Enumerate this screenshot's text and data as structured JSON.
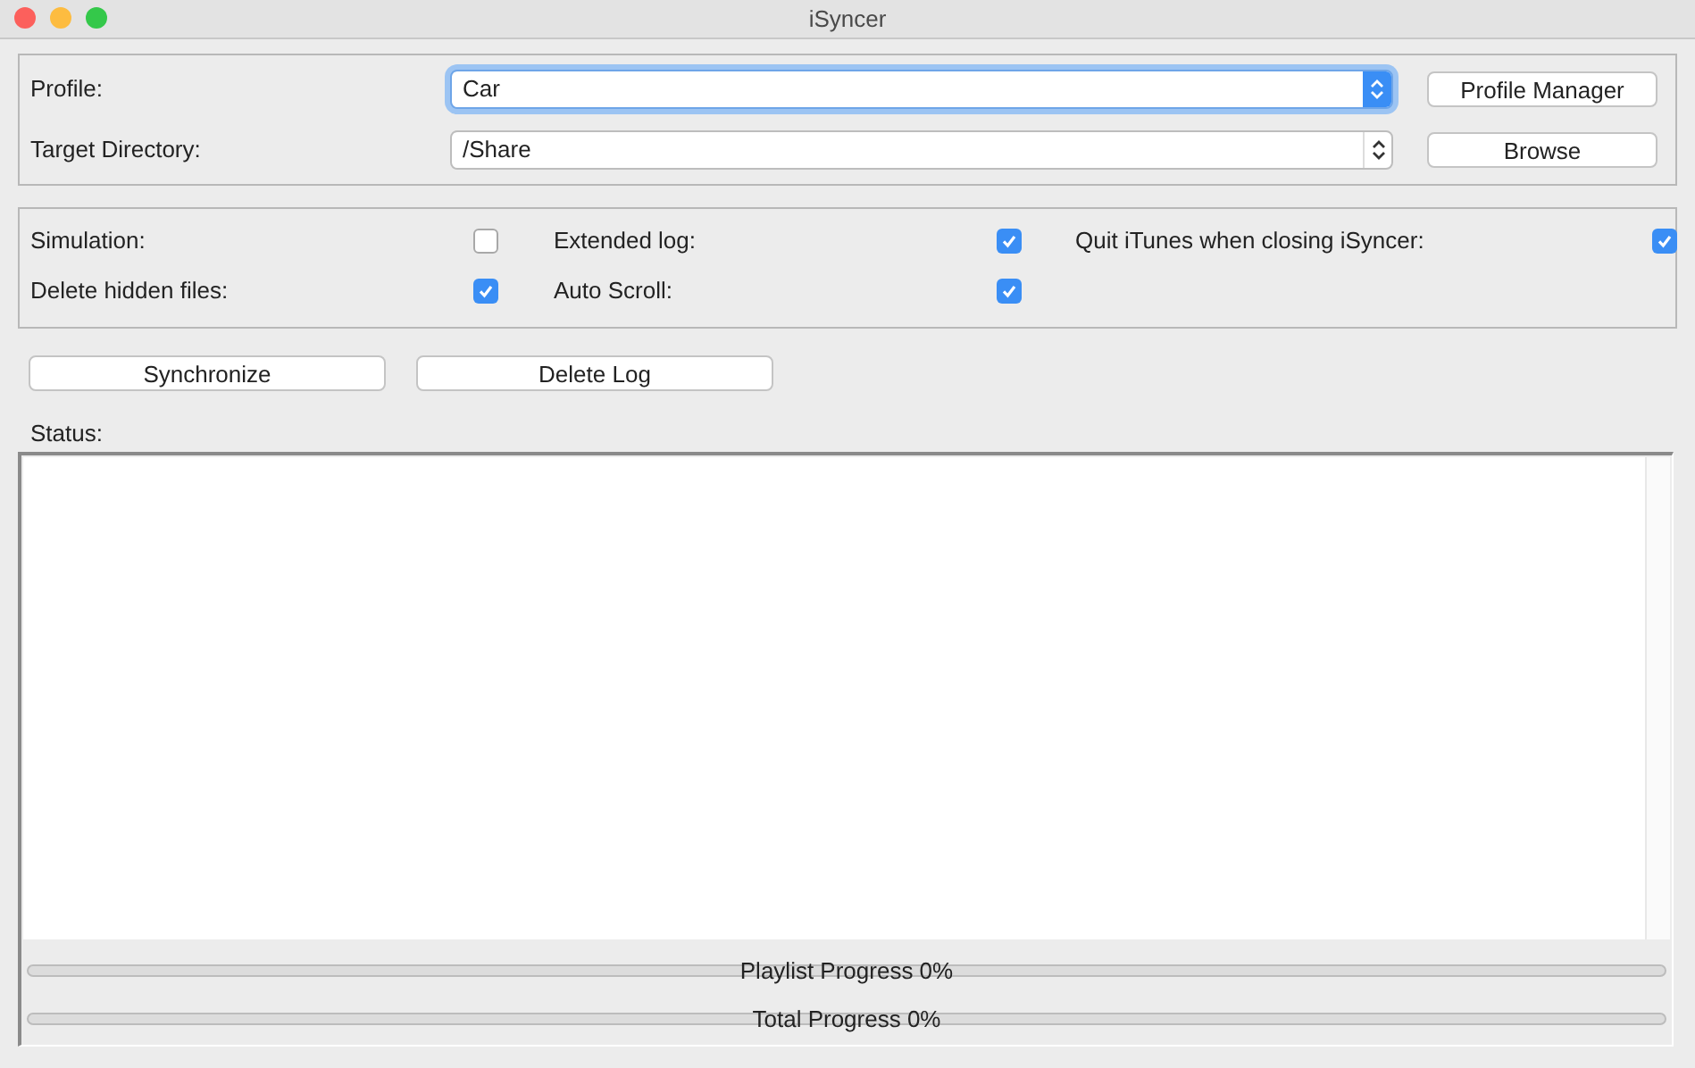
{
  "window": {
    "title": "iSyncer"
  },
  "profile": {
    "label": "Profile:",
    "value": "Car",
    "focused": true
  },
  "profile_manager_button": "Profile Manager",
  "target_directory": {
    "label": "Target Directory:",
    "value": "/Share",
    "focused": false
  },
  "browse_button": "Browse",
  "options": [
    {
      "label": "Simulation:",
      "checked": false
    },
    {
      "label": "Extended log:",
      "checked": true
    },
    {
      "label": "Quit iTunes when closing iSyncer:",
      "checked": true
    },
    {
      "label": "Delete hidden files:",
      "checked": true
    },
    {
      "label": "Auto Scroll:",
      "checked": true
    }
  ],
  "actions": [
    "Synchronize",
    "Delete Log"
  ],
  "status_label": "Status:",
  "progress": [
    {
      "label": "Playlist Progress 0%",
      "level": 0
    },
    {
      "label": "Total Progress 0%",
      "level": 0
    }
  ]
}
